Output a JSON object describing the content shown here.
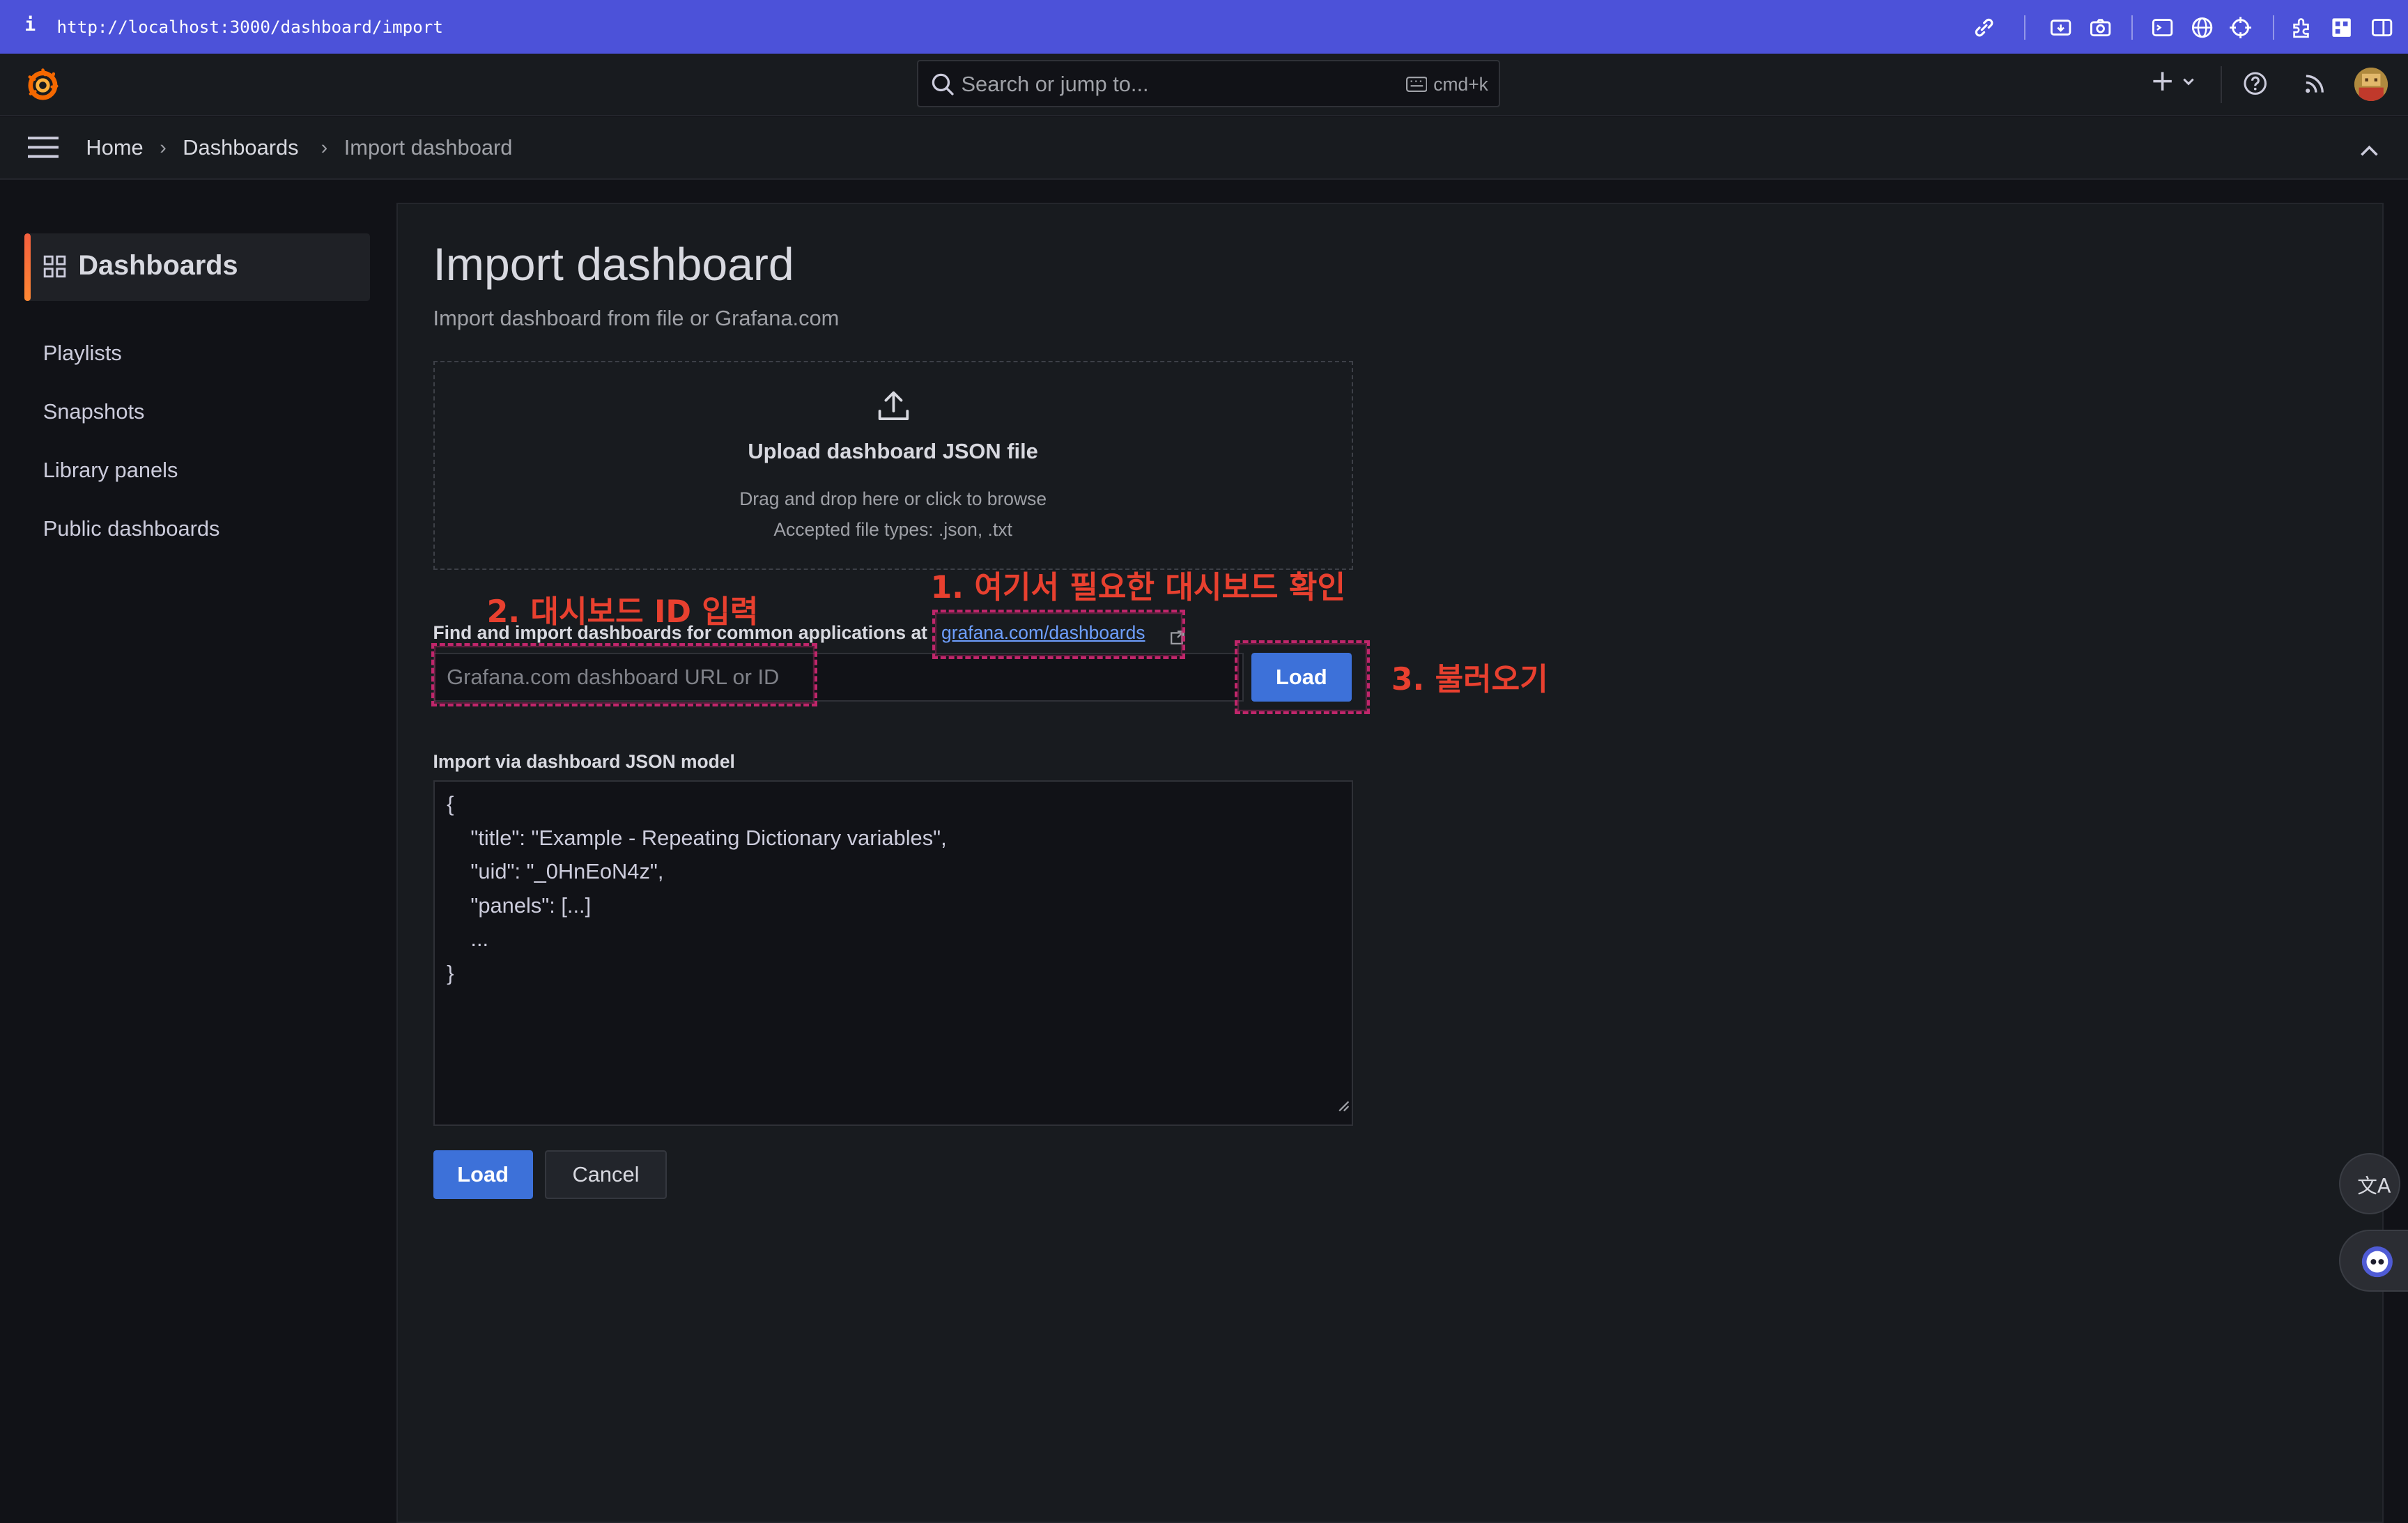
{
  "browser": {
    "info_glyph": "i",
    "url": "http://localhost:3000/dashboard/import"
  },
  "topnav": {
    "search_placeholder": "Search or jump to...",
    "shortcut": "cmd+k"
  },
  "breadcrumb": {
    "items": [
      "Home",
      "Dashboards",
      "Import dashboard"
    ],
    "separator": "›"
  },
  "sidebar": {
    "active": "Dashboards",
    "items": [
      "Playlists",
      "Snapshots",
      "Library panels",
      "Public dashboards"
    ]
  },
  "main": {
    "title": "Import dashboard",
    "subtitle": "Import dashboard from file or Grafana.com",
    "upload": {
      "title": "Upload dashboard JSON file",
      "hint": "Drag and drop here or click to browse",
      "accepted": "Accepted file types: .json, .txt"
    },
    "find_label": "Find and import dashboards for common applications at",
    "grafana_link": "grafana.com/dashboards",
    "url_placeholder": "Grafana.com dashboard URL or ID",
    "load_label": "Load",
    "json_label": "Import via dashboard JSON model",
    "json_lines": [
      "{",
      "    \"title\": \"Example - Repeating Dictionary variables\",",
      "    \"uid\": \"_0HnEoN4z\",",
      "    \"panels\": [...]",
      "    ...",
      "}"
    ],
    "submit_label": "Load",
    "cancel_label": "Cancel"
  },
  "annotations": {
    "step1": "1. 여기서 필요한 대시보드 확인",
    "step2": "2. 대시보드 ID 입력",
    "step3": "3. 불러오기",
    "color": "#e8402f",
    "box_color": "#c0266b"
  },
  "colors": {
    "browser_bar": "#4c52d9",
    "primary": "#3d71d9",
    "accent": "#f55f3e",
    "link": "#6e9fff"
  }
}
